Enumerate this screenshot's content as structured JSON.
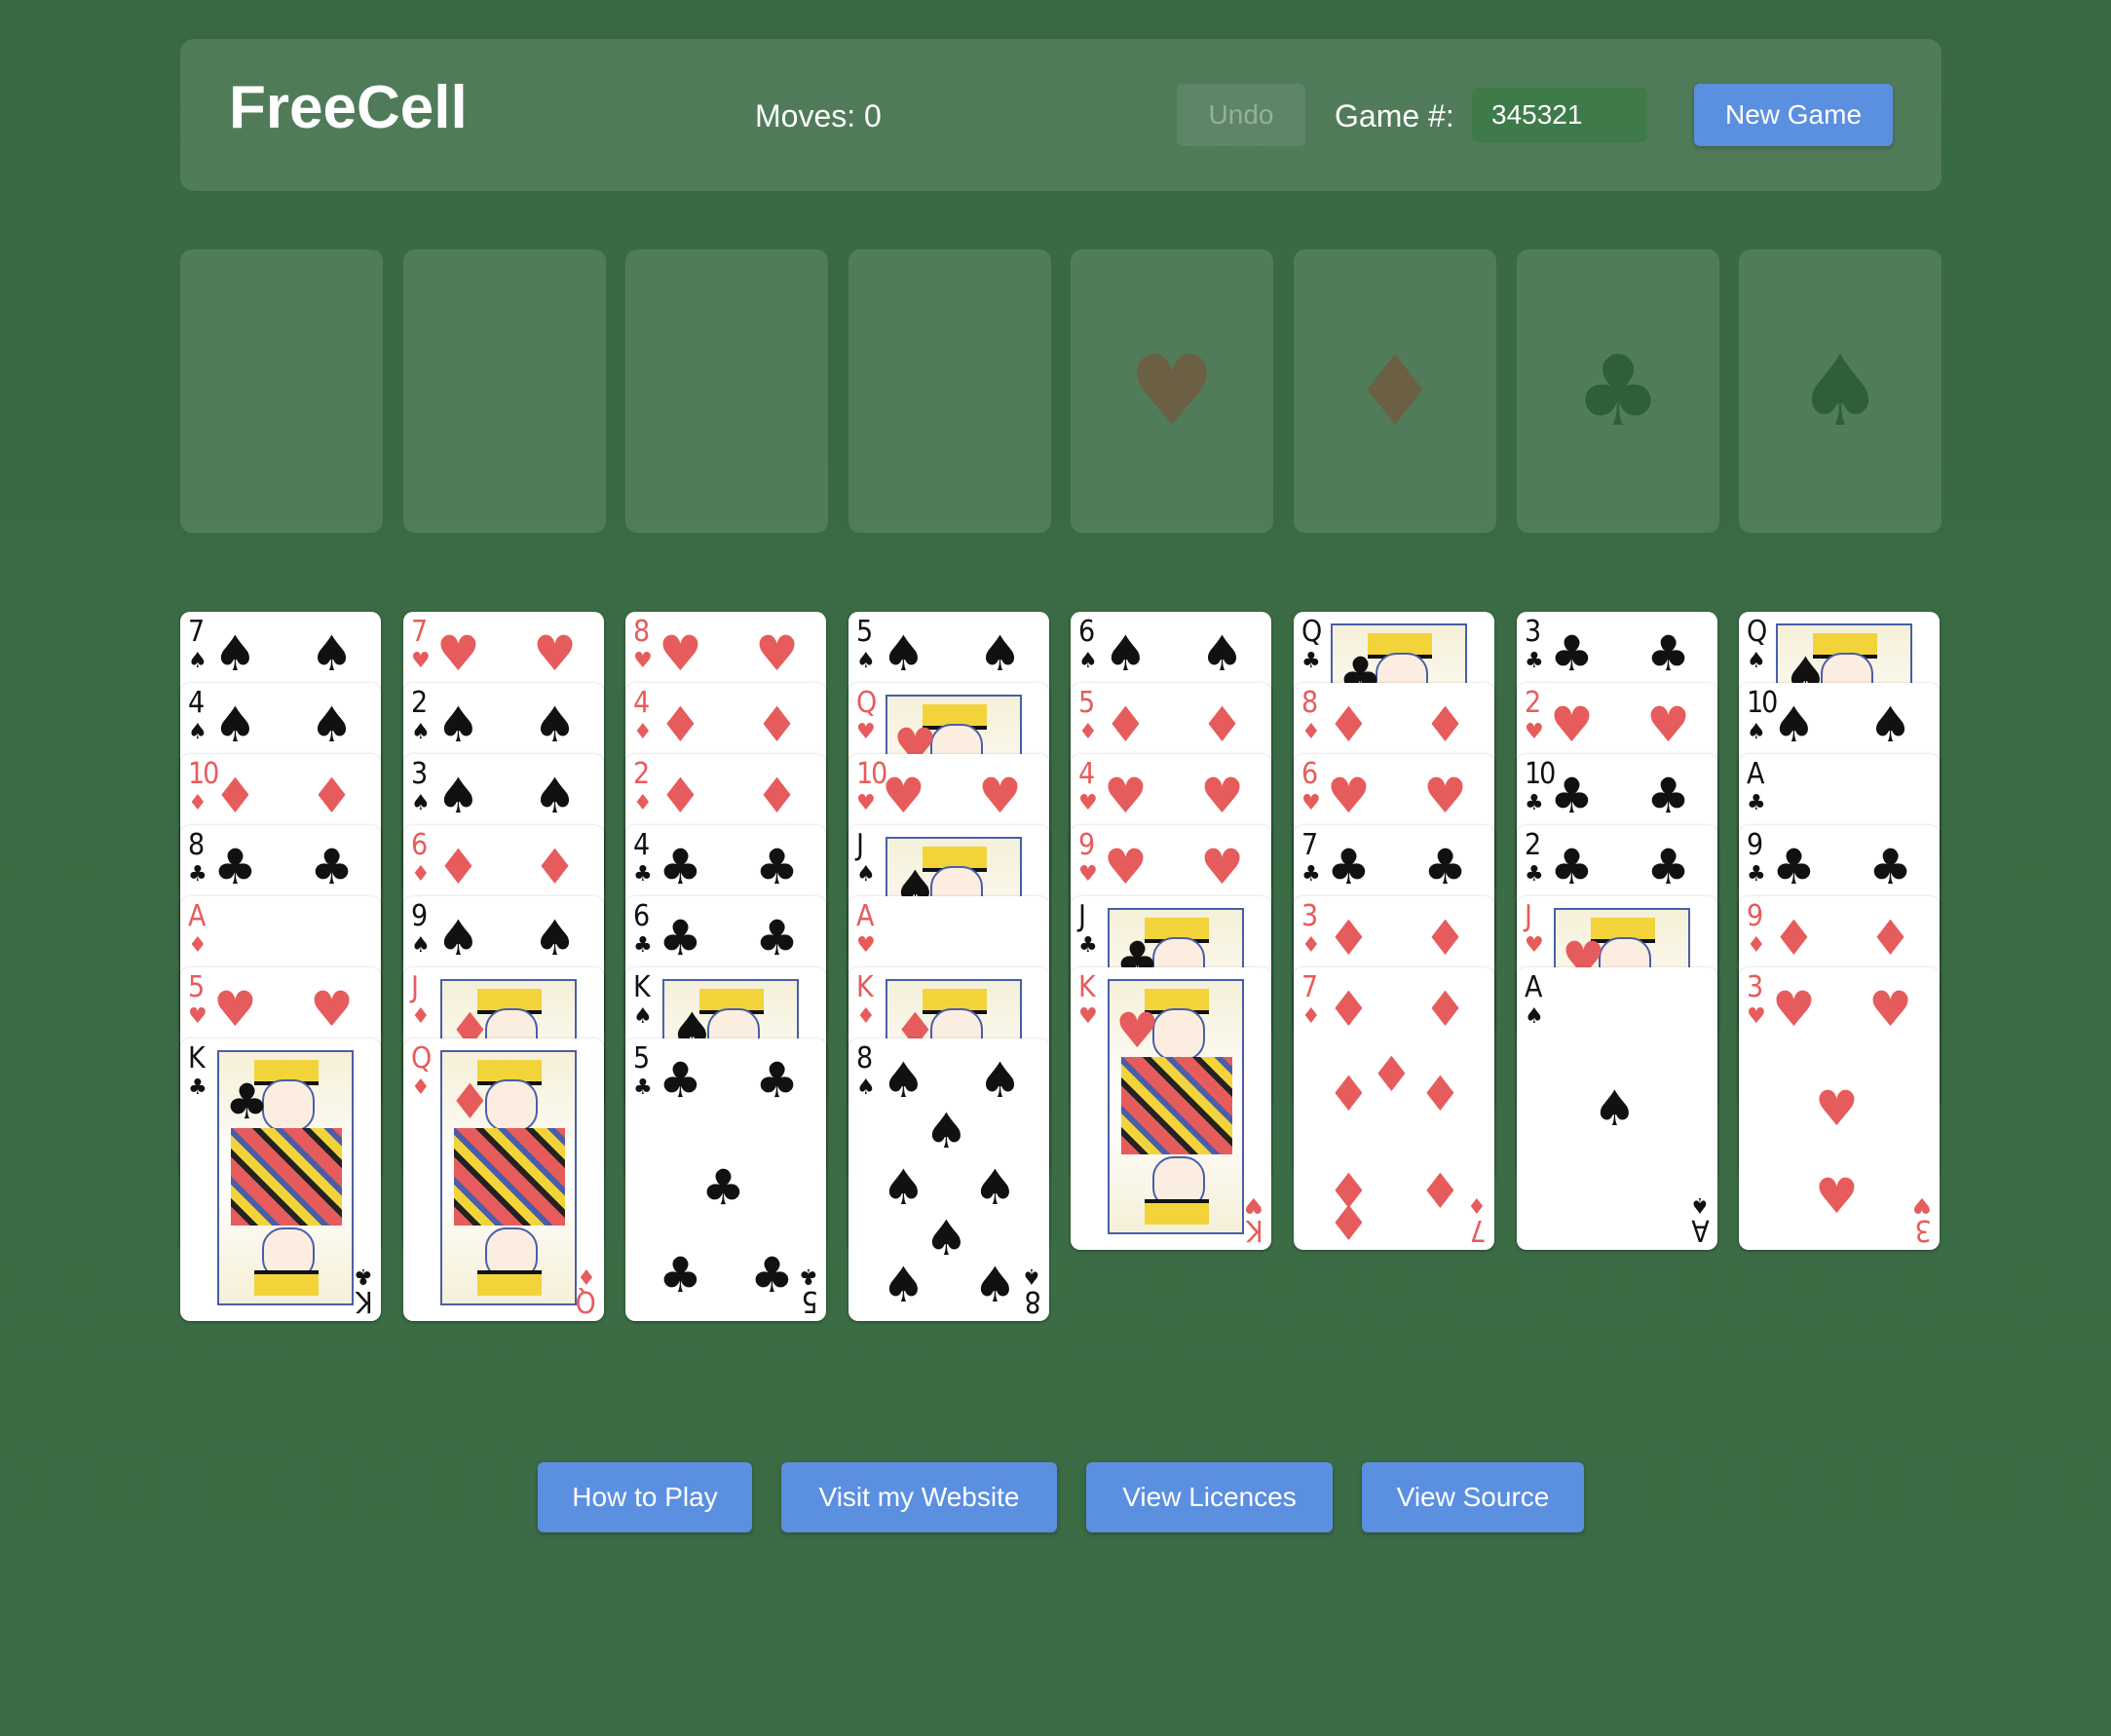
{
  "header": {
    "title": "FreeCell",
    "moves": "Moves: 0",
    "undo_label": "Undo",
    "game_label": "Game #:",
    "game_number": "345321",
    "new_game_label": "New Game"
  },
  "free_cells": [
    {
      "name": "free-cell-1"
    },
    {
      "name": "free-cell-2"
    },
    {
      "name": "free-cell-3"
    },
    {
      "name": "free-cell-4"
    }
  ],
  "foundations": [
    {
      "suit": "♥",
      "icon": "heart-icon",
      "color": "#6b6044"
    },
    {
      "suit": "♦",
      "icon": "diamond-icon",
      "color": "#6b6044"
    },
    {
      "suit": "♣",
      "icon": "club-icon",
      "color": "#2f5f38"
    },
    {
      "suit": "♠",
      "icon": "spade-icon",
      "color": "#2f5f38"
    }
  ],
  "colors": {
    "red": "#e65c5c",
    "black": "#111111",
    "button_blue": "#5b8fe0"
  },
  "tableau": [
    [
      {
        "rank": "7",
        "suit": "♠"
      },
      {
        "rank": "4",
        "suit": "♠"
      },
      {
        "rank": "10",
        "suit": "♦"
      },
      {
        "rank": "8",
        "suit": "♣"
      },
      {
        "rank": "A",
        "suit": "♦"
      },
      {
        "rank": "5",
        "suit": "♥"
      },
      {
        "rank": "K",
        "suit": "♣"
      }
    ],
    [
      {
        "rank": "7",
        "suit": "♥"
      },
      {
        "rank": "2",
        "suit": "♠"
      },
      {
        "rank": "3",
        "suit": "♠"
      },
      {
        "rank": "6",
        "suit": "♦"
      },
      {
        "rank": "9",
        "suit": "♠"
      },
      {
        "rank": "J",
        "suit": "♦"
      },
      {
        "rank": "Q",
        "suit": "♦"
      }
    ],
    [
      {
        "rank": "8",
        "suit": "♥"
      },
      {
        "rank": "4",
        "suit": "♦"
      },
      {
        "rank": "2",
        "suit": "♦"
      },
      {
        "rank": "4",
        "suit": "♣"
      },
      {
        "rank": "6",
        "suit": "♣"
      },
      {
        "rank": "K",
        "suit": "♠"
      },
      {
        "rank": "5",
        "suit": "♣"
      }
    ],
    [
      {
        "rank": "5",
        "suit": "♠"
      },
      {
        "rank": "Q",
        "suit": "♥"
      },
      {
        "rank": "10",
        "suit": "♥"
      },
      {
        "rank": "J",
        "suit": "♠"
      },
      {
        "rank": "A",
        "suit": "♥"
      },
      {
        "rank": "K",
        "suit": "♦"
      },
      {
        "rank": "8",
        "suit": "♠"
      }
    ],
    [
      {
        "rank": "6",
        "suit": "♠"
      },
      {
        "rank": "5",
        "suit": "♦"
      },
      {
        "rank": "4",
        "suit": "♥"
      },
      {
        "rank": "9",
        "suit": "♥"
      },
      {
        "rank": "J",
        "suit": "♣"
      },
      {
        "rank": "K",
        "suit": "♥"
      }
    ],
    [
      {
        "rank": "Q",
        "suit": "♣"
      },
      {
        "rank": "8",
        "suit": "♦"
      },
      {
        "rank": "6",
        "suit": "♥"
      },
      {
        "rank": "7",
        "suit": "♣"
      },
      {
        "rank": "3",
        "suit": "♦"
      },
      {
        "rank": "7",
        "suit": "♦"
      }
    ],
    [
      {
        "rank": "3",
        "suit": "♣"
      },
      {
        "rank": "2",
        "suit": "♥"
      },
      {
        "rank": "10",
        "suit": "♣"
      },
      {
        "rank": "2",
        "suit": "♣"
      },
      {
        "rank": "J",
        "suit": "♥"
      },
      {
        "rank": "A",
        "suit": "♠"
      }
    ],
    [
      {
        "rank": "Q",
        "suit": "♠"
      },
      {
        "rank": "10",
        "suit": "♠"
      },
      {
        "rank": "A",
        "suit": "♣"
      },
      {
        "rank": "9",
        "suit": "♣"
      },
      {
        "rank": "9",
        "suit": "♦"
      },
      {
        "rank": "3",
        "suit": "♥"
      }
    ]
  ],
  "footer": {
    "how_to_play": "How to Play",
    "visit_website": "Visit my Website",
    "view_licences": "View Licences",
    "view_source": "View Source"
  }
}
